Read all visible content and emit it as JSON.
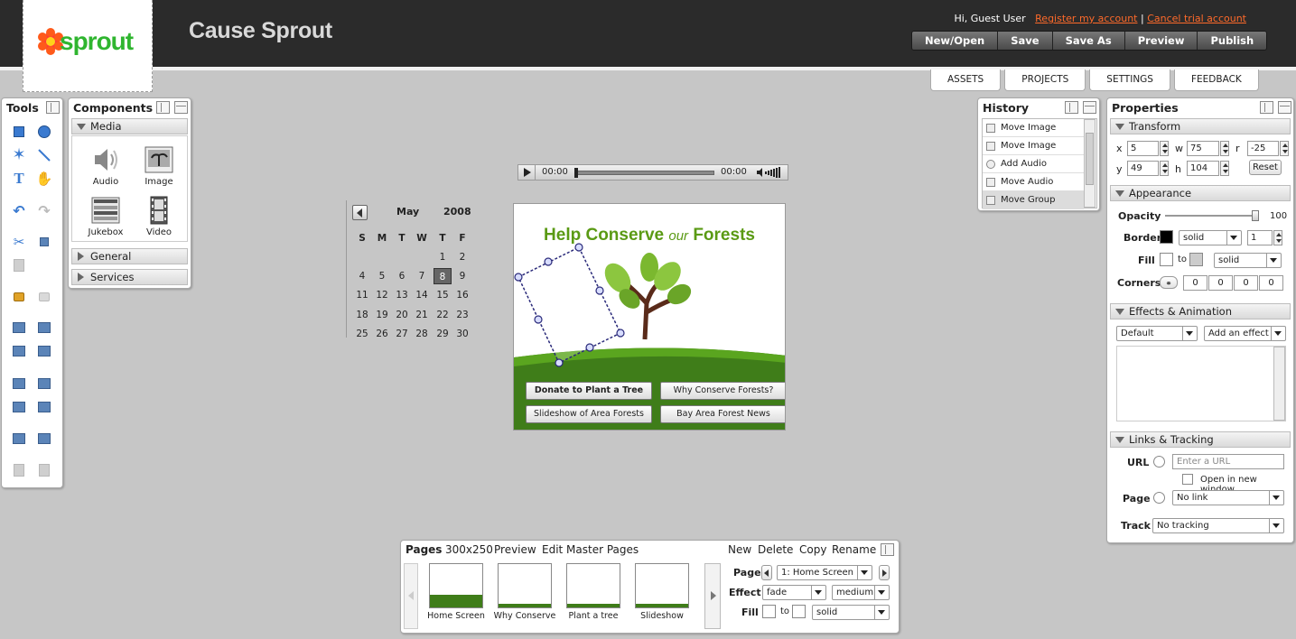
{
  "app": {
    "title": "Cause Sprout",
    "logo_text": "sprout"
  },
  "user_bar": {
    "greeting": "Hi, Guest User",
    "register": "Register my account",
    "separator": "|",
    "cancel": "Cancel trial account"
  },
  "toolbar": [
    "New/Open",
    "Save",
    "Save As",
    "Preview",
    "Publish"
  ],
  "main_tabs": [
    "ASSETS",
    "PROJECTS",
    "SETTINGS",
    "FEEDBACK"
  ],
  "tools": {
    "title": "Tools"
  },
  "components": {
    "title": "Components",
    "media_header": "Media",
    "items": [
      "Audio",
      "Image",
      "Jukebox",
      "Video"
    ],
    "general_header": "General",
    "services_header": "Services"
  },
  "audio_player": {
    "time_start": "00:00",
    "time_end": "00:00"
  },
  "calendar": {
    "month": "May",
    "year": "2008",
    "weekdays": [
      "S",
      "M",
      "T",
      "W",
      "T",
      "F"
    ],
    "rows": [
      [
        "",
        "",
        "",
        "",
        "1",
        "2"
      ],
      [
        "4",
        "5",
        "6",
        "7",
        "8",
        "9"
      ],
      [
        "11",
        "12",
        "13",
        "14",
        "15",
        "16"
      ],
      [
        "18",
        "19",
        "20",
        "21",
        "22",
        "23"
      ],
      [
        "25",
        "26",
        "27",
        "28",
        "29",
        "30"
      ]
    ],
    "selected": "8"
  },
  "canvas": {
    "title_a": "Help Conserve ",
    "title_b": "our",
    "title_c": " Forests",
    "buttons": [
      "Donate to Plant a Tree",
      "Why Conserve Forests?",
      "Slideshow of Area Forests",
      "Bay Area Forest News"
    ]
  },
  "history": {
    "title": "History",
    "items": [
      "Move Image",
      "Move Image",
      "Add Audio",
      "Move Audio",
      "Move Group"
    ]
  },
  "properties": {
    "title": "Properties",
    "transform": {
      "header": "Transform",
      "x_label": "x",
      "x": "5",
      "w_label": "w",
      "w": "75",
      "r_label": "r",
      "r": "-25",
      "y_label": "y",
      "y": "49",
      "h_label": "h",
      "h": "104",
      "reset": "Reset"
    },
    "appearance": {
      "header": "Appearance",
      "opacity_label": "Opacity",
      "opacity": "100",
      "opacity_level": 1.0,
      "border_label": "Border",
      "border_style": "solid",
      "border_width": "1",
      "fill_label": "Fill",
      "fill_to": "to",
      "fill_style": "solid",
      "corners_label": "Corners",
      "corners": [
        "0",
        "0",
        "0",
        "0"
      ]
    },
    "effects": {
      "header": "Effects & Animation",
      "preset": "Default",
      "add": "Add an effect"
    },
    "links": {
      "header": "Links & Tracking",
      "url_label": "URL",
      "url_placeholder": "Enter a URL",
      "new_window": "Open in new window",
      "page_label": "Page",
      "page_value": "No link",
      "track_label": "Track",
      "track_value": "No tracking"
    }
  },
  "pages": {
    "title": "Pages",
    "size": "300x250",
    "preview": "Preview",
    "edit_master": "Edit Master Pages",
    "actions": [
      "New",
      "Delete",
      "Copy",
      "Rename"
    ],
    "page_label": "Page",
    "page_value": "1: Home Screen",
    "effect_label": "Effect",
    "effect_value": "fade",
    "speed_value": "medium",
    "fill_label": "Fill",
    "fill_to": "to",
    "fill_style": "solid",
    "thumbs": [
      "Home Screen",
      "Why Conserve",
      "Plant a tree",
      "Slideshow"
    ]
  },
  "colors": {
    "header_bg": "#2b2b2b",
    "link": "#ff6a2a",
    "brand_green": "#5a9a14",
    "forest_green": "#3f7d19",
    "page_bg": "#c6c6c6"
  }
}
